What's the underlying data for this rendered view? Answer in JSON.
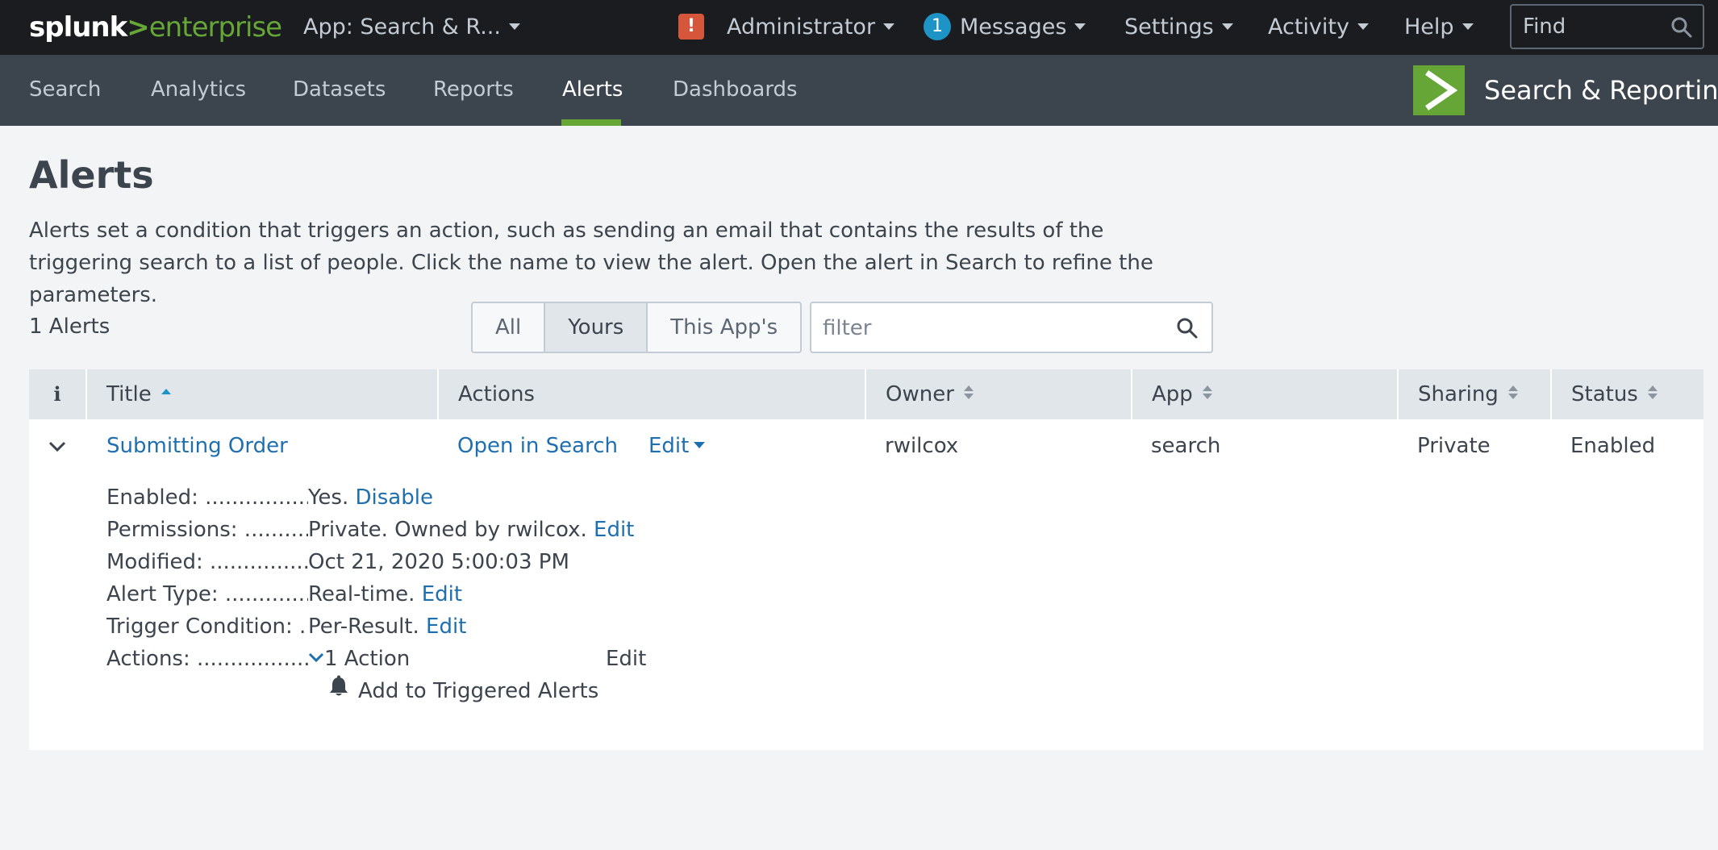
{
  "topbar": {
    "logo_splunk": "splunk",
    "logo_gt": ">",
    "logo_enterprise": "enterprise",
    "app_menu": "App: Search & R...",
    "alert_badge": "!",
    "user_menu": "Administrator",
    "messages_count": "1",
    "messages_menu": "Messages",
    "settings_menu": "Settings",
    "activity_menu": "Activity",
    "help_menu": "Help",
    "find_placeholder": "Find"
  },
  "appbar": {
    "tabs": [
      {
        "label": "Search"
      },
      {
        "label": "Analytics"
      },
      {
        "label": "Datasets"
      },
      {
        "label": "Reports"
      },
      {
        "label": "Alerts"
      },
      {
        "label": "Dashboards"
      }
    ],
    "active_tab": "Alerts",
    "app_name": "Search & Reporting",
    "app_icon": "chevron-right-icon",
    "accent_color": "#65a637"
  },
  "page": {
    "title": "Alerts",
    "description": "Alerts set a condition that triggers an action, such as sending an email that contains the results of the triggering search to a list of people. Click the name to view the alert. Open the alert in Search to refine the parameters.",
    "count_label": "1 Alerts",
    "filter_buttons": [
      "All",
      "Yours",
      "This App's"
    ],
    "selected_filter": "Yours",
    "filter_placeholder": "filter"
  },
  "table": {
    "columns": [
      "i",
      "Title",
      "Actions",
      "Owner",
      "App",
      "Sharing",
      "Status"
    ],
    "rows": [
      {
        "title": "Submitting Order",
        "open_in_search": "Open in Search",
        "edit": "Edit",
        "owner": "rwilcox",
        "app": "search",
        "sharing": "Private",
        "status": "Enabled",
        "details": {
          "enabled_label": "Enabled: ..............................",
          "enabled_value": "Yes.",
          "enabled_link": "Disable",
          "permissions_label": "Permissions: ..............................",
          "permissions_value": "Private. Owned by rwilcox.",
          "permissions_link": "Edit",
          "modified_label": "Modified: ..............................",
          "modified_value": "Oct 21, 2020 5:00:03 PM",
          "alert_type_label": "Alert Type: ..............................",
          "alert_type_value": "Real-time.",
          "alert_type_link": "Edit",
          "trigger_label": "Trigger Condition: ..............................",
          "trigger_value": "Per-Result.",
          "trigger_link": "Edit",
          "actions_label": "Actions: ..............................",
          "actions_value": "1 Action",
          "actions_link": "Edit",
          "action_item": "Add to Triggered Alerts"
        }
      }
    ]
  }
}
